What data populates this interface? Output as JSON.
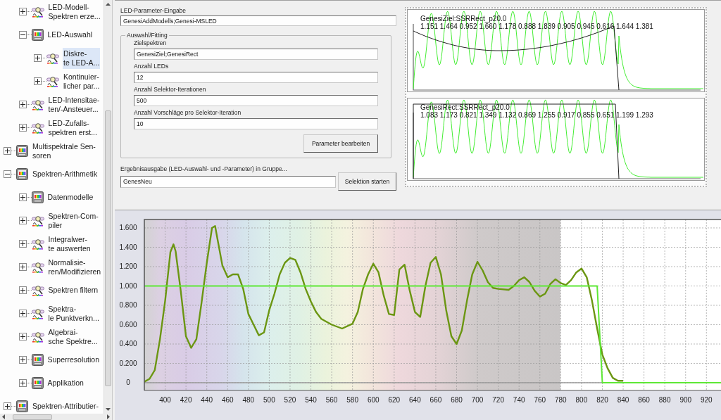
{
  "tree": [
    {
      "children": [
        {
          "label": "LED-Modell-\nSpektren erze...",
          "kind": "tool",
          "expanded": false,
          "selected": false
        },
        {
          "label": "LED-Auswahl",
          "kind": "module",
          "expanded": true,
          "selected": false,
          "children": [
            {
              "label": "Diskre-\nte LED-A...",
              "kind": "tool",
              "expanded": false,
              "selected": true
            },
            {
              "label": "Kontinuier-\nlicher par...",
              "kind": "tool",
              "expanded": false,
              "selected": false
            }
          ]
        },
        {
          "label": "LED-Intensitae-\nten/-Ansteuer...",
          "kind": "tool",
          "expanded": false,
          "selected": false
        },
        {
          "label": "LED-Zufalls-\nspektren erst...",
          "kind": "tool",
          "expanded": false,
          "selected": false
        }
      ]
    },
    {
      "label": "Multispektrale Sen-\nsoren",
      "kind": "module",
      "expanded": false,
      "selected": false
    },
    {
      "label": "Spektren-Arithmetik",
      "kind": "module",
      "expanded": true,
      "selected": false,
      "children": [
        {
          "label": "Datenmodelle",
          "kind": "module",
          "expanded": false,
          "selected": false
        },
        {
          "label": "Spektren-Com-\npiler",
          "kind": "tool",
          "expanded": false,
          "selected": false
        },
        {
          "label": "Integralwer-\nte auswerten",
          "kind": "tool",
          "expanded": false,
          "selected": false
        },
        {
          "label": "Normalisie-\nren/Modifizieren",
          "kind": "tool",
          "expanded": false,
          "selected": false
        },
        {
          "label": "Spektren filtern",
          "kind": "tool",
          "expanded": false,
          "selected": false
        },
        {
          "label": "Spektra-\nle Punktverkn...",
          "kind": "tool",
          "expanded": false,
          "selected": false
        },
        {
          "label": "Algebrai-\nsche Spektre...",
          "kind": "tool",
          "expanded": false,
          "selected": false
        },
        {
          "label": "Superresolution",
          "kind": "module",
          "expanded": false,
          "selected": false
        },
        {
          "label": "Applikation",
          "kind": "module",
          "expanded": false,
          "selected": false
        }
      ]
    },
    {
      "label": "Spektren-Attributier-",
      "kind": "module",
      "expanded": false,
      "selected": false
    }
  ],
  "parameter_input": {
    "label": "LED-Parameter-Eingabe",
    "value": "GenesiAddModells;Genesi-MSLED"
  },
  "fitting_group": {
    "title": "Auswahl/Fitting",
    "fields": [
      {
        "label": "Zielspektren",
        "value": "GenesiZiel;GenesiRect"
      },
      {
        "label": "Anzahl LEDs",
        "value": "12"
      },
      {
        "label": "Anzahl Selektor-Iterationen",
        "value": "500"
      },
      {
        "label": "Anzahl Vorschläge pro Selektor-Iteration",
        "value": "10"
      }
    ],
    "button": "Parameter bearbeiten"
  },
  "output": {
    "label": "Ergebnisausgabe (LED-Auswahl- und -Parameter) in Gruppe...",
    "value": "GenesNeu",
    "button": "Selektion starten"
  },
  "preview_plots": [
    {
      "title": "GenesiZiel:SSRRect_p20.0",
      "values": "1.151 1.464 0.952 1.660 1.178 0.888 1.839 0.905 0.945 0.616 1.644 1.381",
      "kind": "curve"
    },
    {
      "title": "GenesiRect:SSRRect_p20.0",
      "values": "1.083 1.173 0.821 1.349 1.132 0.869 1.255 0.917 0.855 0.651 1.199 1.293",
      "kind": "rect"
    }
  ],
  "spectrum_chart": {
    "chart_data": {
      "type": "line",
      "x": [
        380,
        385,
        390,
        395,
        400,
        405,
        408,
        410,
        415,
        420,
        425,
        430,
        435,
        440,
        445,
        448,
        450,
        455,
        460,
        465,
        470,
        475,
        480,
        485,
        490,
        495,
        500,
        505,
        510,
        515,
        520,
        525,
        530,
        535,
        540,
        545,
        550,
        560,
        570,
        580,
        585,
        590,
        595,
        600,
        605,
        610,
        615,
        620,
        625,
        630,
        635,
        640,
        645,
        650,
        655,
        660,
        665,
        670,
        675,
        680,
        685,
        690,
        695,
        700,
        705,
        710,
        715,
        720,
        730,
        735,
        740,
        745,
        750,
        755,
        760,
        765,
        770,
        775,
        780,
        785,
        790,
        795,
        800,
        805,
        810,
        815,
        820,
        825,
        830,
        835,
        840,
        880,
        920,
        934
      ],
      "series": [
        {
          "color": "#6b9612",
          "values": [
            0.01,
            0.04,
            0.13,
            0.45,
            0.85,
            1.35,
            1.43,
            1.36,
            0.95,
            0.48,
            0.36,
            0.45,
            0.83,
            1.24,
            1.6,
            1.62,
            1.5,
            1.21,
            1.09,
            1.12,
            1.12,
            0.97,
            0.71,
            0.6,
            0.49,
            0.52,
            0.75,
            0.92,
            1.12,
            1.24,
            1.29,
            1.27,
            1.14,
            0.97,
            0.84,
            0.73,
            0.66,
            0.6,
            0.56,
            0.61,
            0.73,
            0.97,
            1.12,
            1.23,
            1.14,
            0.9,
            0.71,
            0.7,
            1.17,
            1.22,
            0.95,
            0.73,
            0.68,
            1.0,
            1.24,
            1.3,
            1.12,
            0.75,
            0.48,
            0.4,
            0.54,
            0.85,
            1.12,
            1.25,
            1.16,
            1.04,
            0.98,
            0.97,
            0.96,
            1.0,
            1.06,
            1.09,
            1.04,
            0.95,
            0.89,
            0.92,
            1.02,
            1.07,
            1.03,
            1.01,
            1.06,
            1.14,
            1.18,
            1.09,
            0.85,
            0.56,
            0.29,
            0.15,
            0.05,
            0.02,
            0.02,
            null,
            null,
            null
          ]
        },
        {
          "color": "#5ee836",
          "values": [
            1,
            1,
            1,
            1,
            1,
            1,
            1,
            1,
            1,
            1,
            1,
            1,
            1,
            1,
            1,
            1,
            1,
            1,
            1,
            1,
            1,
            1,
            1,
            1,
            1,
            1,
            1,
            1,
            1,
            1,
            1,
            1,
            1,
            1,
            1,
            1,
            1,
            1,
            1,
            1,
            1,
            1,
            1,
            1,
            1,
            1,
            1,
            1,
            1,
            1,
            1,
            1,
            1,
            1,
            1,
            1,
            1,
            1,
            1,
            1,
            1,
            1,
            1,
            1,
            1,
            1,
            1,
            1,
            1,
            1,
            1,
            1,
            1,
            1,
            1,
            1,
            1,
            1,
            1,
            1,
            1,
            1,
            1,
            1,
            1,
            1,
            0,
            0,
            0,
            0,
            0,
            0,
            0,
            0
          ]
        }
      ],
      "xlim": [
        380,
        934
      ],
      "ylim": [
        -0.08,
        1.687
      ],
      "grid": true,
      "xticks": [
        400,
        420,
        440,
        460,
        480,
        500,
        520,
        540,
        560,
        580,
        600,
        620,
        640,
        660,
        680,
        700,
        720,
        740,
        760,
        780,
        800,
        820,
        840,
        860,
        880,
        900,
        920
      ],
      "yticks": [
        {
          "value": 0,
          "label": "0"
        },
        {
          "value": 0.2,
          "label": "0.200"
        },
        {
          "value": 0.4,
          "label": "0.400"
        },
        {
          "value": 0.6,
          "label": "0.600"
        },
        {
          "value": 0.8,
          "label": "0.800"
        },
        {
          "value": 1.0,
          "label": "1.000"
        },
        {
          "value": 1.2,
          "label": "1.200"
        },
        {
          "value": 1.4,
          "label": "1.400"
        },
        {
          "value": 1.6,
          "label": "1.600"
        }
      ]
    }
  }
}
